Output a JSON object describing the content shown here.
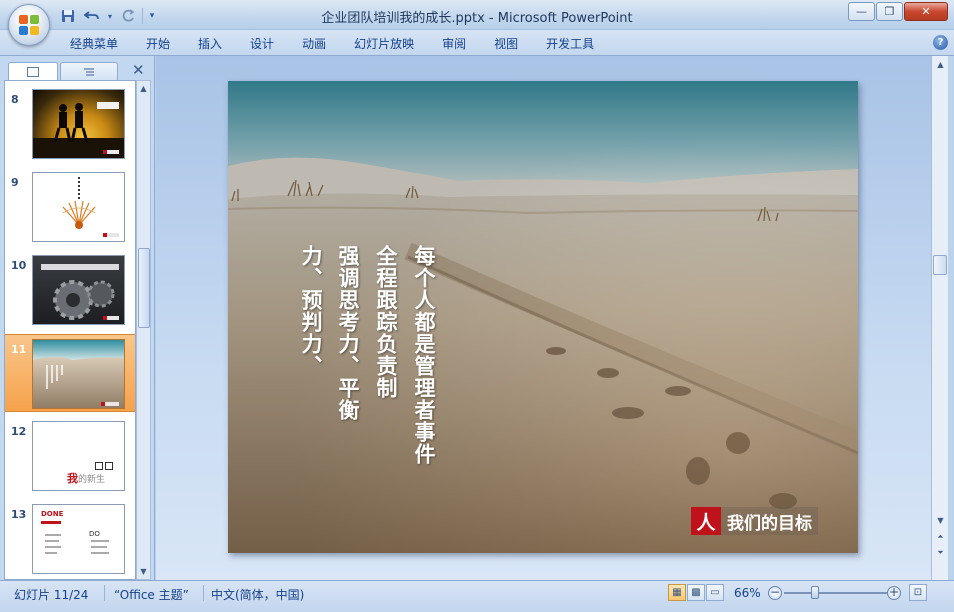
{
  "window": {
    "title": "企业团队培训我的成长.pptx - Microsoft PowerPoint",
    "minimize": "—",
    "restore": "❐",
    "close": "✕"
  },
  "quick_access": {
    "save_icon": "save-icon",
    "undo_icon": "undo-icon",
    "redo_icon": "redo-icon",
    "customize_icon": "customize-icon"
  },
  "ribbon": {
    "tabs": [
      "经典菜单",
      "开始",
      "插入",
      "设计",
      "动画",
      "幻灯片放映",
      "审阅",
      "视图",
      "开发工具"
    ],
    "help": "?"
  },
  "left_pane": {
    "close": "✕",
    "thumbnails": [
      {
        "number": "8"
      },
      {
        "number": "9"
      },
      {
        "number": "10"
      },
      {
        "number": "11",
        "selected": true
      },
      {
        "number": "12",
        "caption_main": "我",
        "caption_rest": "的新生"
      },
      {
        "number": "13",
        "caption_main": "DONE",
        "caption_rest": "DO"
      }
    ]
  },
  "slide": {
    "lines": [
      "每个人都是管理者事件",
      "全程跟踪负责制",
      "强调思考力、平衡",
      "力、预判力、"
    ],
    "badge_mark": "人",
    "badge_text": "我们的目标"
  },
  "status": {
    "slide_position": "幻灯片 11/24",
    "theme": "“Office 主题”",
    "language": "中文(简体，中国)",
    "zoom": "66%",
    "zoom_minus": "−",
    "zoom_plus": "+"
  },
  "colors": {
    "accent_red": "#c0121a",
    "ribbon_text": "#15428b",
    "selected_thumb": "#f6a24b"
  }
}
